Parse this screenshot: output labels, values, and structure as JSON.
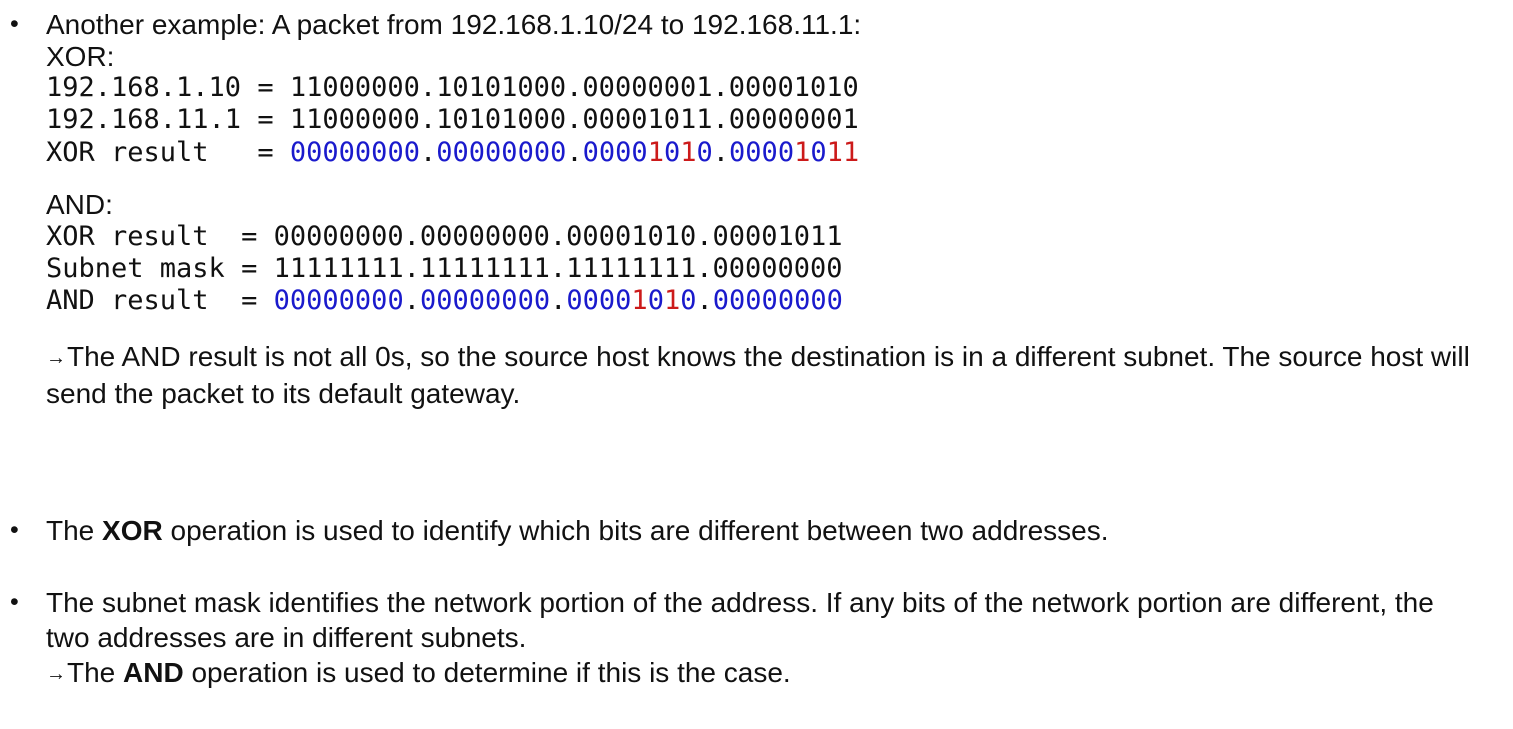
{
  "colors": {
    "text": "#111111",
    "zero_highlight": "#1a1acc",
    "one_highlight": "#cc1a1a"
  },
  "bullet1": {
    "intro": "Another example: A packet from 192.168.1.10/24 to 192.168.11.1:",
    "xor_heading": "XOR:",
    "xor_lines": [
      "192.168.1.10 = 11000000.10101000.00000001.00001010",
      "192.168.11.1 = 11000000.10101000.00001011.00000001"
    ],
    "xor_result_prefix": "XOR result   = ",
    "xor_result_bits": "00000000.00000000.00001010.00001011",
    "and_heading": "AND:",
    "and_lines": [
      "XOR result  = 00000000.00000000.00001010.00001011",
      "Subnet mask = 11111111.11111111.11111111.00000000"
    ],
    "and_result_prefix": "AND result  = ",
    "and_result_bits": "00000000.00000000.00001010.00000000",
    "conclusion_arrow": "→",
    "conclusion": "The AND result is not all 0s, so the source host knows the destination is in a different subnet. The source host will send the packet to its default gateway."
  },
  "bullet2": {
    "pre": "The ",
    "bold": "XOR",
    "post": " operation is used to identify which bits are different between two addresses."
  },
  "bullet3": {
    "text": "The subnet mask identifies the network portion of the address. If any bits of the network portion are different, the two addresses are in different subnets.",
    "arrow": "→",
    "pre": "The ",
    "bold": "AND",
    "post": " operation is used to determine if this is the case."
  }
}
